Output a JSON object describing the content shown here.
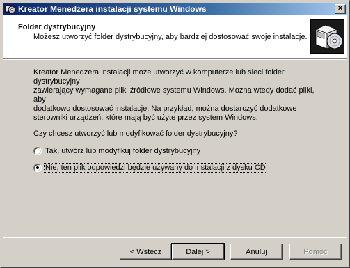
{
  "window": {
    "title": "Kreator Menedżera instalacji systemu Windows",
    "close_glyph": "×"
  },
  "header": {
    "title": "Folder dystrybucyjny",
    "subtitle": "Możesz utworzyć folder dystrybucyjny, aby bardziej dostosować swoje instalacje.",
    "graphic_icon": "cd-box-icon"
  },
  "body": {
    "description_lines": [
      "Kreator Menedżera instalacji może utworzyć w komputerze lub sieci folder dystrybucyjny",
      "zawierający wymagane pliki źródłowe systemu Windows. Można wtedy dodać pliki, aby",
      "dodatkowo dostosować instalacje. Na przykład, można dostarczyć dodatkowe",
      "sterowniki urządzeń, które mają być użyte przez system Windows."
    ],
    "question": "Czy chcesz utworzyć lub modyfikować folder dystrybucyjny?",
    "options": [
      {
        "label": "Tak, utwórz lub modyfikuj folder dystrybucyjny",
        "checked": false
      },
      {
        "label": "Nie, ten plik odpowiedzi będzie używany do instalacji z dysku CD",
        "checked": true
      }
    ]
  },
  "buttons": {
    "back": "< Wstecz",
    "next": "Dalej >",
    "cancel": "Anuluj",
    "help": "Pomoc"
  }
}
